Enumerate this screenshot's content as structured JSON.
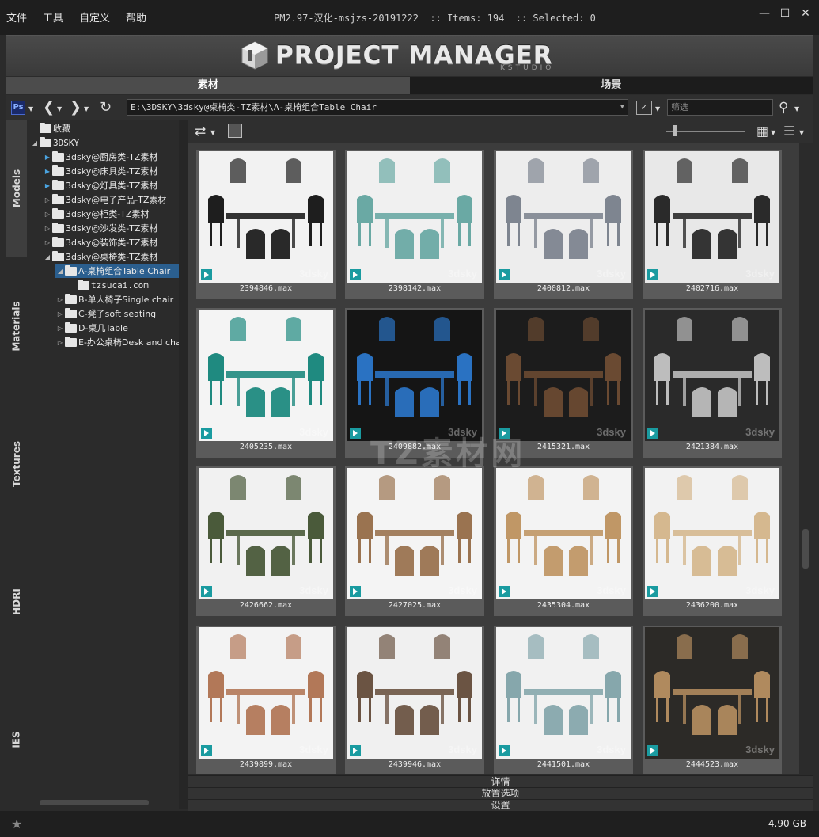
{
  "menu": [
    "文件",
    "工具",
    "自定义",
    "帮助"
  ],
  "title_info": "PM2.97-汉化-msjzs-20191222  :: Items: 194  :: Selected: 0",
  "window": {
    "min": "—",
    "max": "☐",
    "close": "✕"
  },
  "banner": {
    "title": "PROJECT MANAGER",
    "sub": "KSTUDIO"
  },
  "tabs": [
    {
      "label": "素材",
      "active": true
    },
    {
      "label": "场景",
      "active": false
    }
  ],
  "pathbar": {
    "path": "E:\\3DSKY\\3dsky@桌椅类-TZ素材\\A-桌椅组合Table Chair",
    "filter_placeholder": "筛选",
    "ps_icon": "Ps"
  },
  "vertical_tabs": [
    "Models",
    "Materials",
    "Textures",
    "HDRI",
    "IES"
  ],
  "tree": [
    {
      "label": "收藏",
      "level": 0,
      "icon": "star-folder"
    },
    {
      "label": "3DSKY",
      "level": 0,
      "expanded": true
    },
    {
      "label": "3dsky@厨房类-TZ素材",
      "level": 1
    },
    {
      "label": "3dsky@床具类-TZ素材",
      "level": 1
    },
    {
      "label": "3dsky@灯具类-TZ素材",
      "level": 1
    },
    {
      "label": "3dsky@电子产品-TZ素材",
      "level": 1
    },
    {
      "label": "3dsky@柜类-TZ素材",
      "level": 1
    },
    {
      "label": "3dsky@沙发类-TZ素材",
      "level": 1
    },
    {
      "label": "3dsky@装饰类-TZ素材",
      "level": 1
    },
    {
      "label": "3dsky@桌椅类-TZ素材",
      "level": 1,
      "expanded": true
    },
    {
      "label": "A-桌椅组合Table Chair",
      "level": 2,
      "expanded": true,
      "selected": true
    },
    {
      "label": "tzsucai.com",
      "level": 3
    },
    {
      "label": "B-单人椅子Single chair",
      "level": 2
    },
    {
      "label": "C-凳子soft seating",
      "level": 2
    },
    {
      "label": "D-桌几Table",
      "level": 2
    },
    {
      "label": "E-办公桌椅Desk and chair",
      "level": 2
    }
  ],
  "items": [
    {
      "name": "2394846.max",
      "bg": "#f2f2f2",
      "fg": "#1e1e1e"
    },
    {
      "name": "2398142.max",
      "bg": "#f0f0f0",
      "fg": "#6aa9a4"
    },
    {
      "name": "2400812.max",
      "bg": "#ededed",
      "fg": "#7e8590"
    },
    {
      "name": "2402716.max",
      "bg": "#e8e8e8",
      "fg": "#2a2a2a"
    },
    {
      "name": "2405235.max",
      "bg": "#f4f4f4",
      "fg": "#1f8a80"
    },
    {
      "name": "2409882.max",
      "bg": "#151515",
      "fg": "#2a72c2"
    },
    {
      "name": "2415321.max",
      "bg": "#1c1c1c",
      "fg": "#6a4a32"
    },
    {
      "name": "2421384.max",
      "bg": "#2a2a2a",
      "fg": "#bdbdbd"
    },
    {
      "name": "2426662.max",
      "bg": "#f1f1f1",
      "fg": "#4a5a3a"
    },
    {
      "name": "2427025.max",
      "bg": "#f4f4f4",
      "fg": "#9a7350"
    },
    {
      "name": "2435304.max",
      "bg": "#f3f3f3",
      "fg": "#c09766"
    },
    {
      "name": "2436200.max",
      "bg": "#f2f2f2",
      "fg": "#d5b88f"
    },
    {
      "name": "2439899.max",
      "bg": "#f3f3f3",
      "fg": "#b27858"
    },
    {
      "name": "2439946.max",
      "bg": "#f0f0f0",
      "fg": "#6b5443"
    },
    {
      "name": "2441501.max",
      "bg": "#f1f1f1",
      "fg": "#86a7ac"
    },
    {
      "name": "2444523.max",
      "bg": "#2c2a27",
      "fg": "#b08a5e"
    }
  ],
  "thumb_watermark": "3dsky",
  "big_watermark": "TZ素材网",
  "bottom_sections": [
    "详情",
    "放置选项",
    "设置"
  ],
  "status": {
    "disk": "4.90 GB"
  },
  "colors": {
    "selection": "#2b5f8f",
    "accent": "#1a9ba0"
  }
}
